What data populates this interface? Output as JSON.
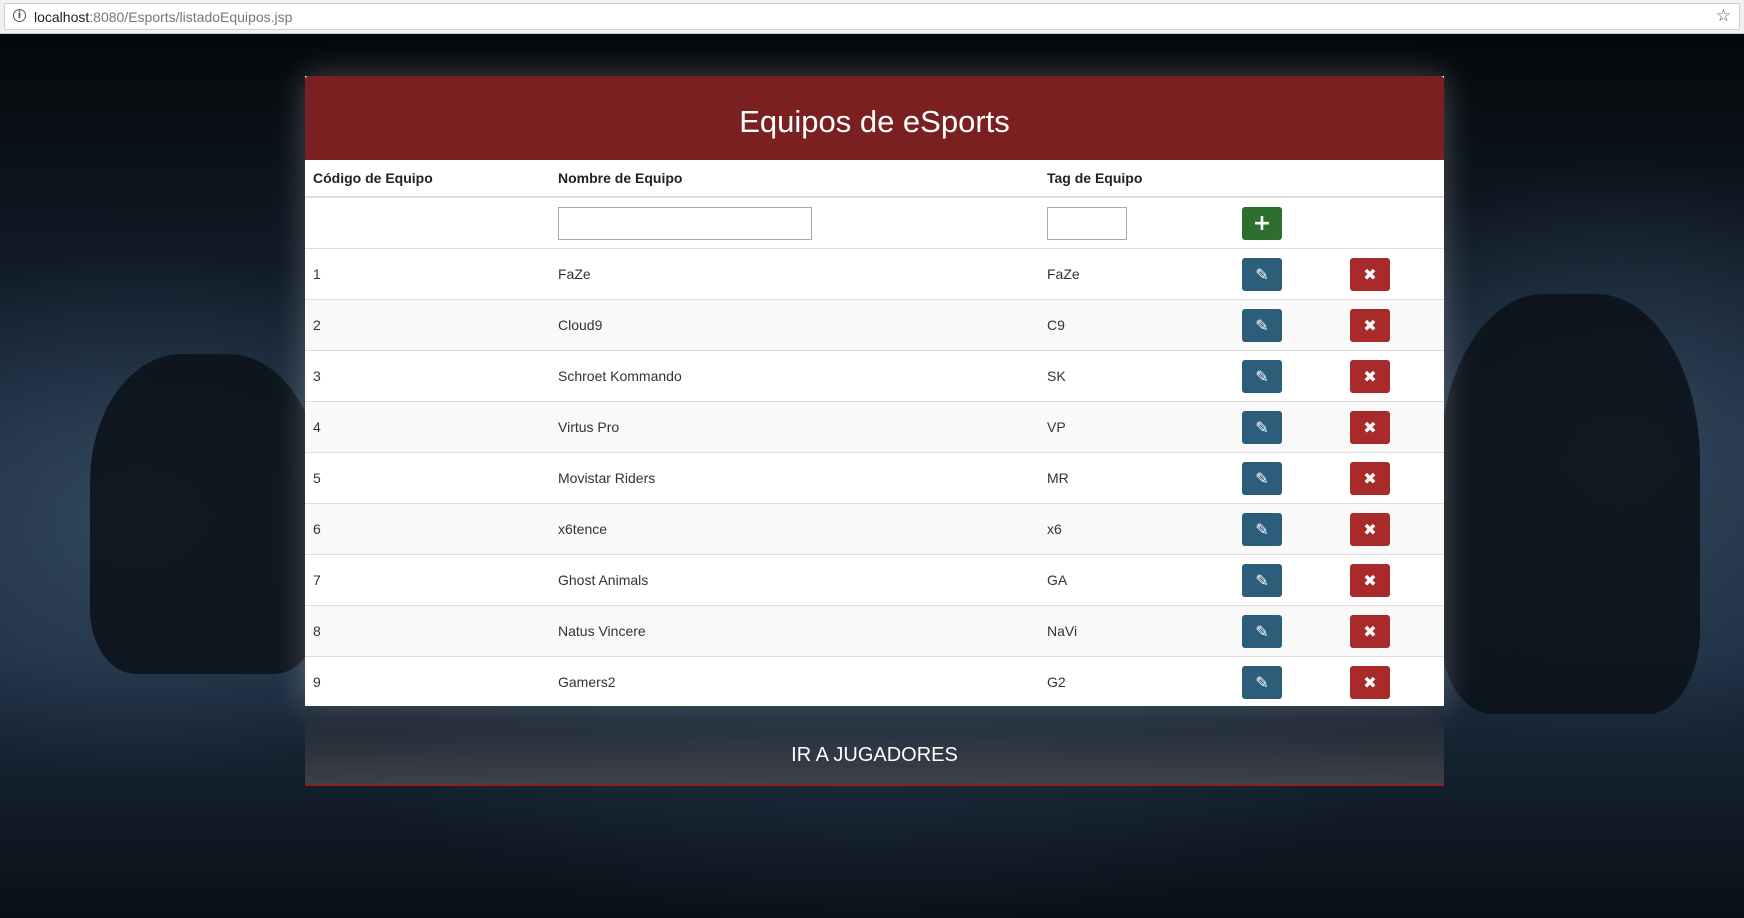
{
  "browser": {
    "url_host": "localhost",
    "url_path": ":8080/Esports/listadoEquipos.jsp",
    "info_icon": "info-icon",
    "star_icon": "star-icon"
  },
  "page": {
    "title": "Equipos de eSports",
    "footer_link": "IR A JUGADORES"
  },
  "table": {
    "headers": [
      "Código de Equipo",
      "Nombre de Equipo",
      "Tag de Equipo"
    ],
    "new_row": {
      "nombre_value": "",
      "tag_value": ""
    },
    "rows": [
      {
        "codigo": "1",
        "nombre": "FaZe",
        "tag": "FaZe"
      },
      {
        "codigo": "2",
        "nombre": "Cloud9",
        "tag": "C9"
      },
      {
        "codigo": "3",
        "nombre": "Schroet Kommando",
        "tag": "SK"
      },
      {
        "codigo": "4",
        "nombre": "Virtus Pro",
        "tag": "VP"
      },
      {
        "codigo": "5",
        "nombre": "Movistar Riders",
        "tag": "MR"
      },
      {
        "codigo": "6",
        "nombre": "x6tence",
        "tag": "x6"
      },
      {
        "codigo": "7",
        "nombre": "Ghost Animals",
        "tag": "GA"
      },
      {
        "codigo": "8",
        "nombre": "Natus Vincere",
        "tag": "NaVi"
      },
      {
        "codigo": "9",
        "nombre": "Gamers2",
        "tag": "G2"
      }
    ]
  },
  "icons": {
    "add": "plus-icon",
    "edit": "pencil-icon",
    "delete": "close-icon"
  },
  "colors": {
    "header_bg": "#7a2020",
    "add_button": "#2e6e2e",
    "edit_button": "#2c5d7a",
    "delete_button": "#a82a2a"
  }
}
